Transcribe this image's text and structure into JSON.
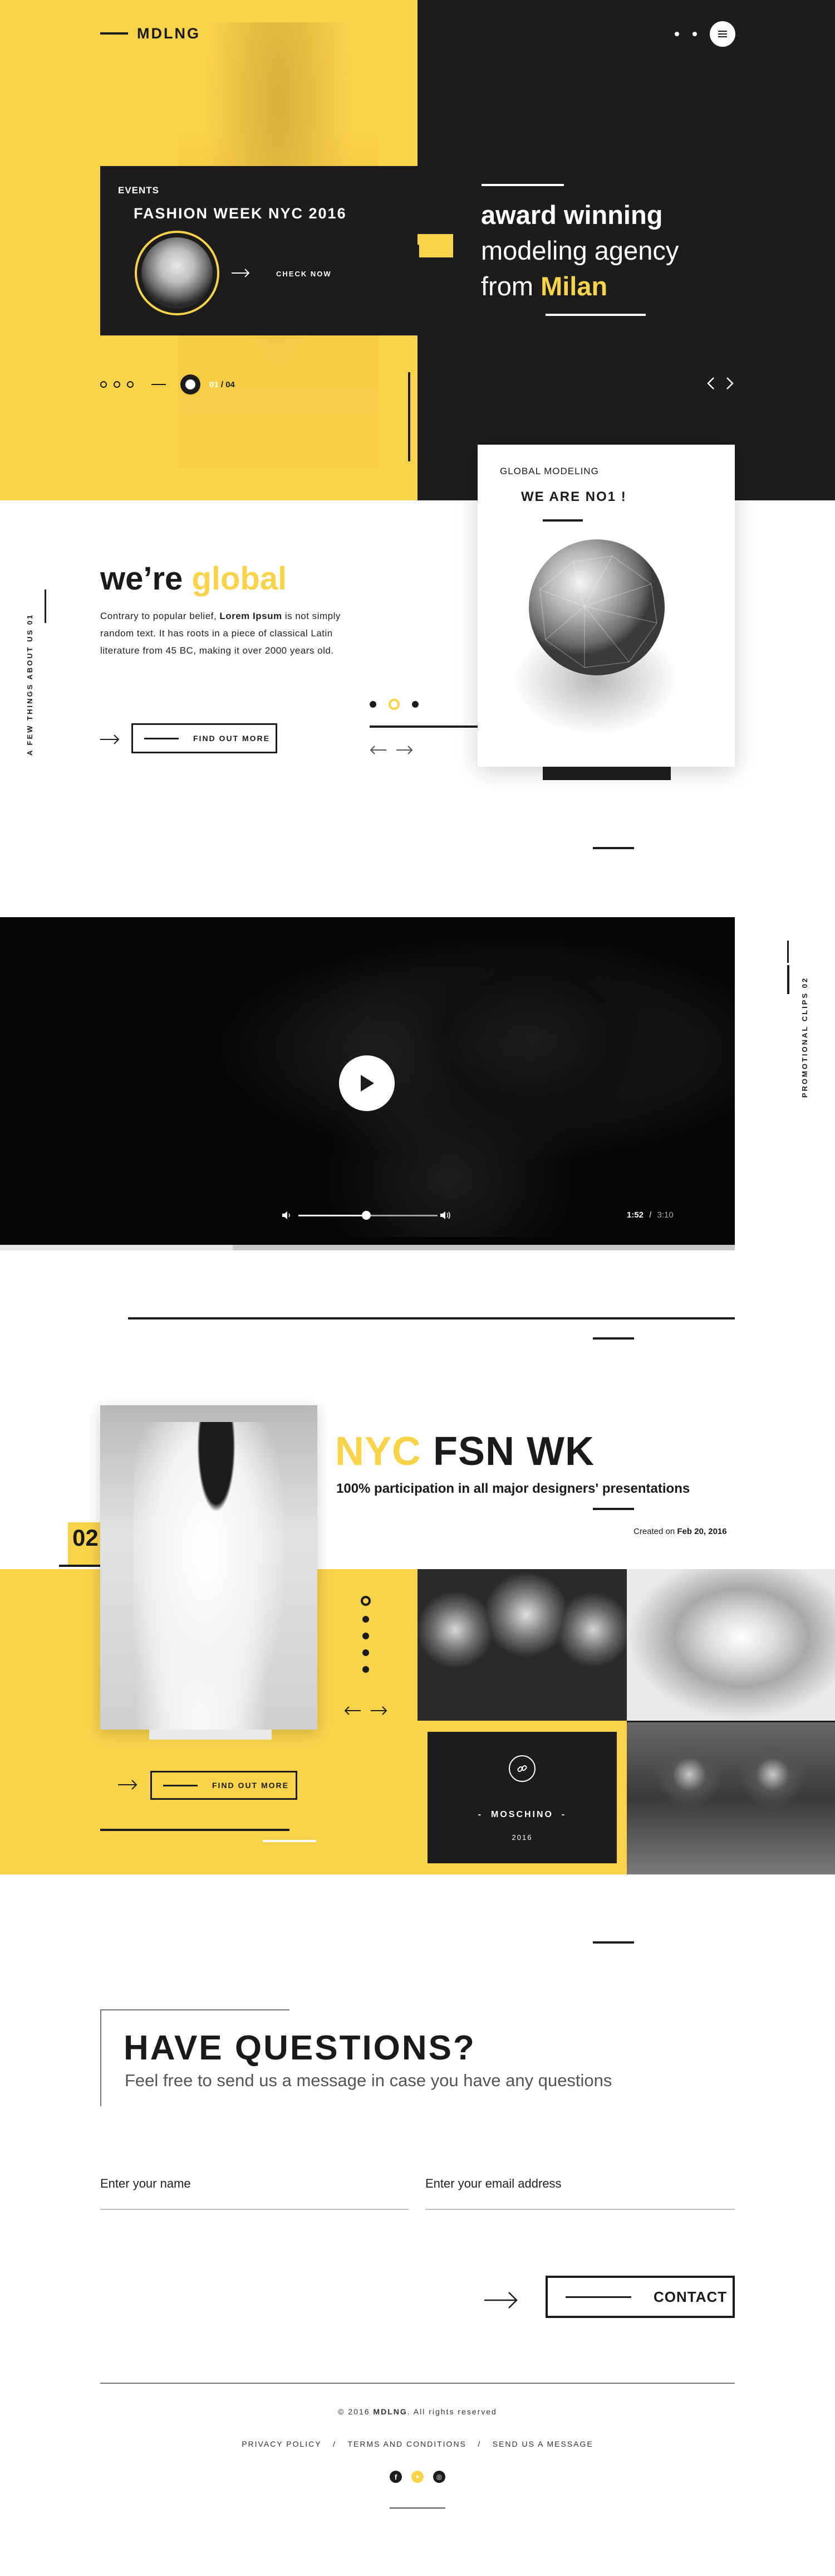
{
  "brand": {
    "logo": "MDLNG"
  },
  "hero": {
    "events_label": "EVENTS",
    "event_title": "FASHION WEEK NYC 2016",
    "check_now": "CHECK NOW",
    "slide_number": "01",
    "pager_current": "01",
    "pager_total": "/ 04",
    "headline_1": "award winning",
    "headline_2": "modeling agency",
    "headline_3": "from",
    "headline_city": "Milan"
  },
  "about": {
    "side_label": "A FEW THINGS ABOUT US 01",
    "title_start": "we’re",
    "title_accent": "global",
    "body_1": "Contrary to popular belief,",
    "body_bold": "Lorem Ipsum",
    "body_2": "is not simply random text. It has roots in a piece of classical Latin literature from 45 BC, making it over 2000 years old.",
    "button": "FIND OUT MORE",
    "card_label": "GLOBAL MODELING",
    "card_title": "WE ARE NO1 !"
  },
  "video": {
    "side_label": "PROMOTIONAL CLIPS 02",
    "time_current": "1:52",
    "time_sep": "/",
    "time_total": "3:10",
    "progress": 0.42,
    "volume": 0.6
  },
  "fashion": {
    "number": "02",
    "title_accent": "NYC",
    "title_rest": "FSN WK",
    "subtitle": "100% participation in all major designers' presentations",
    "created_prefix": "Created on",
    "created_date": "Feb 20, 2016",
    "button": "FIND OUT MORE",
    "brand_name": "MOSCHINO",
    "brand_year": "2016"
  },
  "contact": {
    "title": "HAVE QUESTIONS?",
    "subtitle": "Feel free to send us a message in case you have any questions",
    "name_placeholder": "Enter your name",
    "email_placeholder": "Enter your email address",
    "button": "CONTACT"
  },
  "footer": {
    "copyright_pre": "© 2016",
    "copyright_brand": "MDLNG",
    "copyright_post": ". All rights reserved",
    "links": [
      "PRIVACY POLICY",
      "TERMS AND CONDITIONS",
      "SEND US A MESSAGE"
    ],
    "separator": "/",
    "socials": [
      "f",
      "●",
      "◎"
    ]
  },
  "colors": {
    "accent": "#f9d34a",
    "dark": "#1c1c1c"
  }
}
